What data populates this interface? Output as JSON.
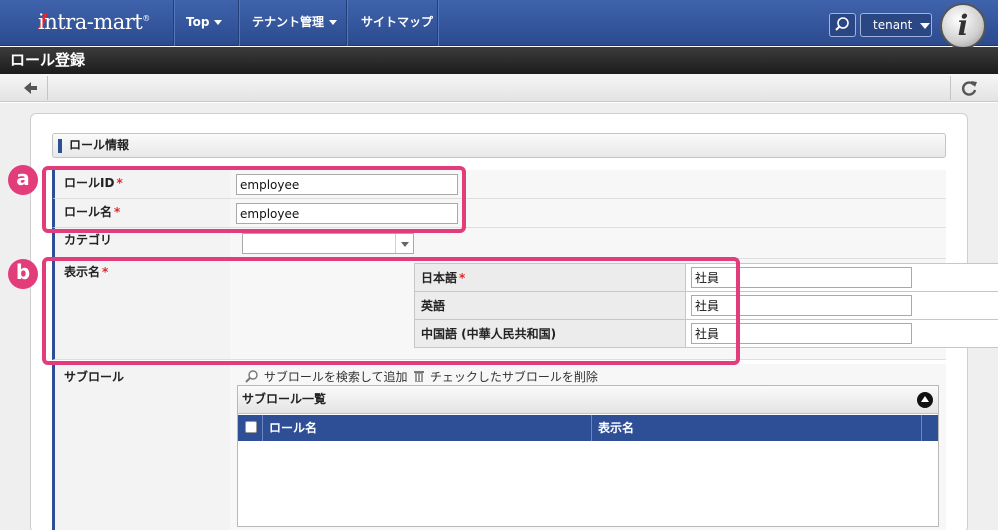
{
  "header": {
    "logo_text": "intra-mart",
    "nav": [
      "Top",
      "テナント管理",
      "サイトマップ"
    ],
    "tenant_label": "tenant"
  },
  "page": {
    "title": "ロール登録"
  },
  "section": {
    "title": "ロール情報"
  },
  "form": {
    "role_id": {
      "label": "ロールID",
      "required_mark": "*",
      "value": "employee"
    },
    "role_name": {
      "label": "ロール名",
      "required_mark": "*",
      "value": "employee"
    },
    "category": {
      "label": "カテゴリ",
      "value": ""
    },
    "display_name": {
      "label": "表示名",
      "required_mark": "*",
      "languages": [
        {
          "lang": "日本語",
          "required_mark": "*",
          "value": "社員"
        },
        {
          "lang": "英語",
          "required_mark": "",
          "value": "社員"
        },
        {
          "lang": "中国語 (中華人民共和国)",
          "required_mark": "",
          "value": "社員"
        }
      ]
    },
    "sub_role": {
      "label": "サブロール",
      "search_add": "サブロールを検索して追加",
      "delete_checked": "チェックしたサブロールを削除",
      "grid_title": "サブロール一覧",
      "columns": [
        "ロール名",
        "表示名"
      ]
    }
  },
  "annotations": [
    "a",
    "b"
  ],
  "colors": {
    "nav": "#2f4f94",
    "accent": "#2e4f96",
    "highlight": "#e23c7a",
    "required": "#e0272b"
  }
}
